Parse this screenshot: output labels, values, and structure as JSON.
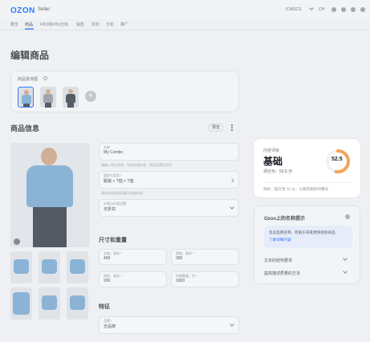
{
  "header": {
    "logo": "OZON",
    "logo_sub": "Seller",
    "account": "ICMSCS",
    "lang": "CH"
  },
  "nav": {
    "items": [
      "概览",
      "商品",
      "FBO和FBS仓库",
      "销售",
      "财务",
      "分析",
      "推广"
    ],
    "active_index": 1
  },
  "page": {
    "title": "编辑商品"
  },
  "variants": {
    "label": "商品变体图"
  },
  "product_info": {
    "title": "商品信息",
    "action_button": "预览",
    "fields": {
      "name_label": "名称",
      "name_value": "My Combo",
      "name_hint": "请输入商品名称，包含关键信息，例如品牌及型号",
      "category_label": "类别与类型 *",
      "category_value": "服装 > T恤 > T恤",
      "category_hint": "请先选择类别再填写其他信息",
      "price_label": "价格与价格设置",
      "price_value": "无折扣"
    }
  },
  "dimensions": {
    "title": "尺寸和重量",
    "length_label": "长度，毫米 *",
    "length_value": "400",
    "width_label": "宽度，毫米 *",
    "width_value": "350",
    "height_label": "高度，毫米 *",
    "height_value": "200",
    "weight_label": "包装重量，克 *",
    "weight_value": "1000"
  },
  "attributes": {
    "title": "特征",
    "field_label": "品牌 *",
    "field_value": "无品牌"
  },
  "rating_card": {
    "caption": "内容评级",
    "level": "基础",
    "sub": "评分为：52.5 分",
    "note": "目标：提升至 70 分，以获得更好的曝光",
    "score": "52.5",
    "score_fraction": 0.525,
    "gauge_color": "#f5a35a"
  },
  "ozon_tips": {
    "title": "Ozon上的名称提示",
    "blue_note": "包含品牌名称，有助于买家更快找到商品",
    "blue_link": "了解详细内容",
    "row1": "文本的结构要求",
    "row2": "提高描述质量的方法"
  },
  "colors": {
    "accent": "#005bff",
    "shirt": "#6fa3cf"
  }
}
